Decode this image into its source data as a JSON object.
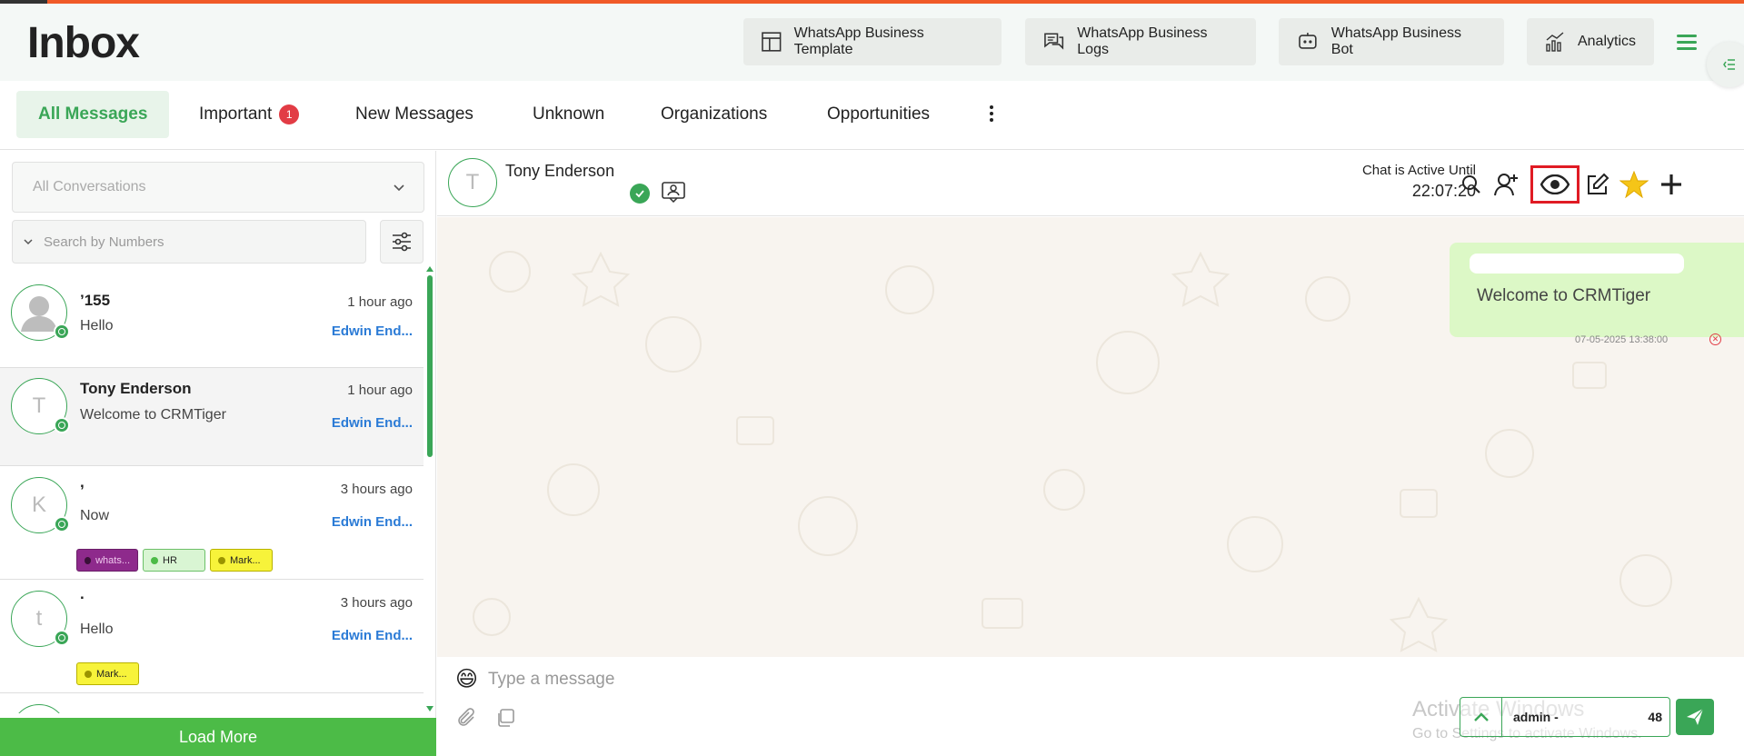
{
  "header": {
    "title": "Inbox",
    "buttons": [
      {
        "label": "WhatsApp Business Template",
        "icon": "template-icon"
      },
      {
        "label": "WhatsApp Business Logs",
        "icon": "logs-icon"
      },
      {
        "label": "WhatsApp Business Bot",
        "icon": "bot-icon"
      },
      {
        "label": "Analytics",
        "icon": "analytics-icon"
      }
    ]
  },
  "tabs": [
    {
      "label": "All Messages",
      "active": true
    },
    {
      "label": "Important",
      "badge": "1"
    },
    {
      "label": "New Messages"
    },
    {
      "label": "Unknown"
    },
    {
      "label": "Organizations"
    },
    {
      "label": "Opportunities"
    }
  ],
  "left": {
    "conversation_filter": "All Conversations",
    "search_placeholder": "Search by Numbers",
    "load_more": "Load More",
    "conversations": [
      {
        "name": "’155",
        "time": "1 hour ago",
        "message": "Hello",
        "owner": "Edwin End...",
        "avatar_letter": "",
        "tags": []
      },
      {
        "name": "Tony Enderson",
        "time": "1 hour ago",
        "message": "Welcome to CRMTiger",
        "owner": "Edwin End...",
        "avatar_letter": "T",
        "tags": []
      },
      {
        "name": ",",
        "time": "3 hours ago",
        "message": "Now",
        "owner": "Edwin End...",
        "avatar_letter": "K",
        "tags": [
          {
            "label": "whats...",
            "bg": "#8e2a8c",
            "dot": "#3a1038",
            "color": "#f0c8ee"
          },
          {
            "label": "HR",
            "bg": "#d9f5d3",
            "dot": "#4cbb47",
            "color": "#222"
          },
          {
            "label": "Mark...",
            "bg": "#f7f33a",
            "dot": "#9a9400",
            "color": "#222"
          }
        ]
      },
      {
        "name": ".",
        "time": "3 hours ago",
        "message": "Hello",
        "owner": "Edwin End...",
        "avatar_letter": "t",
        "tags": [
          {
            "label": "Mark...",
            "bg": "#f7f33a",
            "dot": "#9a9400",
            "color": "#222"
          }
        ]
      }
    ]
  },
  "chat": {
    "contact_name": "Tony Enderson",
    "avatar_letter": "T",
    "active_label": "Chat is Active Until",
    "active_time": "22:07:20",
    "message": {
      "text": "Welcome to CRMTiger",
      "timestamp": "07-05-2025 13:38:00"
    },
    "composer_placeholder": "Type a message",
    "agent_name": "admin -",
    "agent_number": "48",
    "watermark_title": "Activate Windows",
    "watermark_sub": "Go to Settings to activate Windows."
  }
}
